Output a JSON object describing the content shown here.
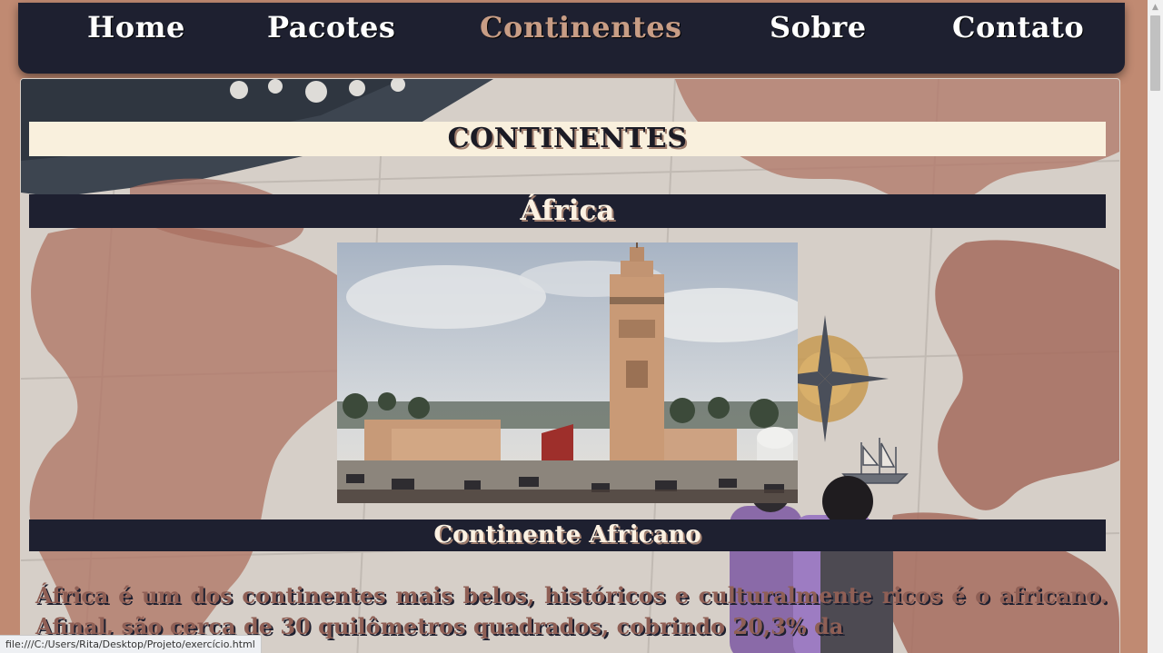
{
  "nav": {
    "items": [
      {
        "label": "Home"
      },
      {
        "label": "Pacotes"
      },
      {
        "label": "Continentes",
        "active": true
      },
      {
        "label": "Sobre"
      },
      {
        "label": "Contato"
      }
    ]
  },
  "main": {
    "page_title": "CONTINENTES",
    "section_title": "África",
    "subsection_title": "Continente Africano",
    "paragraph": "África é um dos continentes mais belos, históricos e culturalmente ricos é o africano. Afinal, são cerca de 30 quilômetros quadrados, cobrindo 20,3% da"
  },
  "status_bar": {
    "url": "file:///C:/Users/Rita/Desktop/Projeto/exercício.html"
  },
  "colors": {
    "page_background": "#c08a72",
    "nav_background": "#1e2030",
    "active_nav": "#c89d85",
    "title_bar": "#f9f0dd"
  }
}
